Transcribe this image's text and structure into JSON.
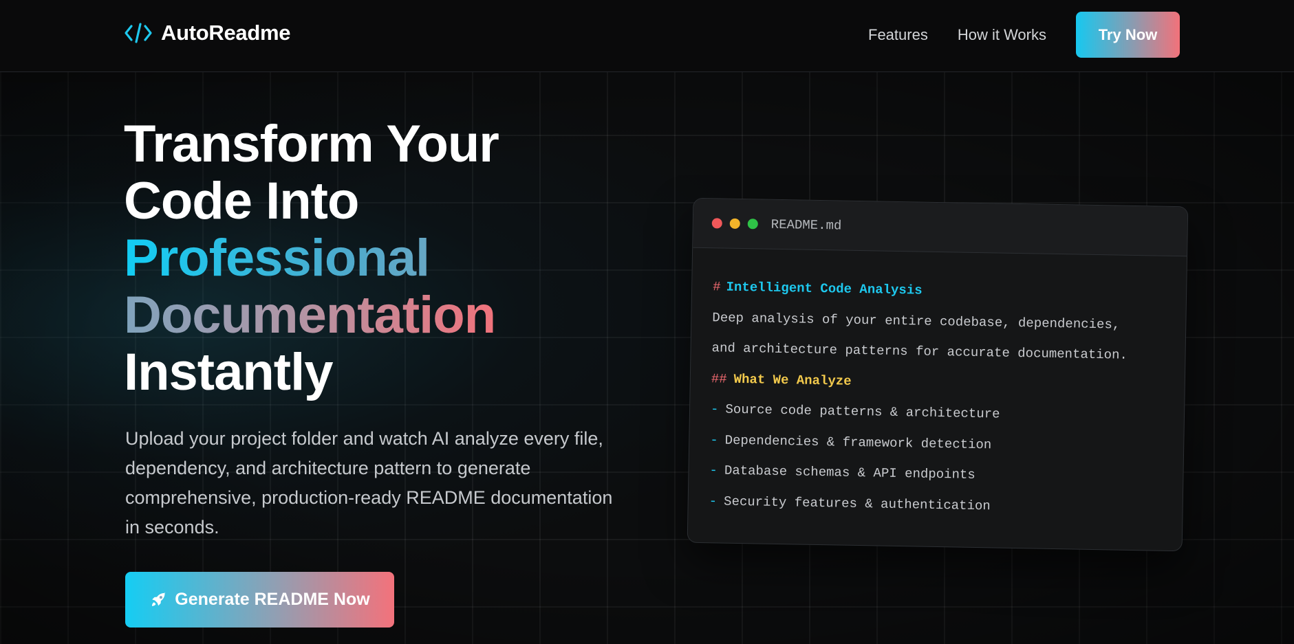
{
  "header": {
    "brand": "AutoReadme",
    "nav": [
      "Features",
      "How it Works"
    ],
    "cta_label": "Try Now"
  },
  "hero": {
    "title_line1": "Transform Your",
    "title_line2": "Code Into",
    "title_highlight1": "Professional",
    "title_highlight2": "Documentation",
    "title_line5": "Instantly",
    "subtitle": "Upload your project folder and watch AI analyze every file, dependency, and architecture pattern to generate comprehensive, production-ready README documentation in seconds.",
    "cta_label": "Generate README Now",
    "cta_icon": "rocket-icon"
  },
  "readme_card": {
    "filename": "README.md",
    "h1_marker": "#",
    "h1": "Intelligent Code Analysis",
    "paragraph_line1": "Deep analysis of your entire codebase, dependencies,",
    "paragraph_line2": "and architecture patterns for accurate documentation.",
    "h2_marker": "##",
    "h2": "What We Analyze",
    "bullet_marker": "-",
    "bullets": [
      "Source code patterns & architecture",
      "Dependencies & framework detection",
      "Database schemas & API endpoints",
      "Security features & authentication"
    ]
  },
  "colors": {
    "accent_cyan": "#17c8ef",
    "accent_coral": "#f2727a",
    "background": "#0c0d0e",
    "window_red": "#f1585a",
    "window_yellow": "#f3b42a",
    "window_green": "#2fc247",
    "heading2": "#f2c94c"
  }
}
